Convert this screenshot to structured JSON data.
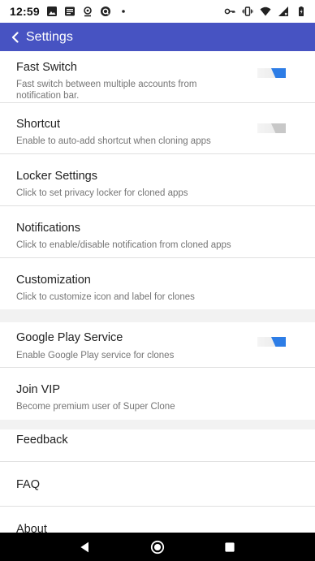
{
  "status_bar": {
    "time": "12:59",
    "left_icons": [
      "image-icon",
      "news-icon",
      "location-icon",
      "q-app-icon",
      "dot-icon"
    ],
    "right_icons": [
      "key-icon",
      "vibrate-icon",
      "wifi-icon",
      "signal-icon",
      "battery-icon"
    ]
  },
  "app_bar": {
    "title": "Settings",
    "color": "#4753c2"
  },
  "settings": [
    {
      "title": "Fast Switch",
      "subtitle": "Fast switch between multiple accounts from notification bar.",
      "toggle": true
    },
    {
      "title": "Shortcut",
      "subtitle": "Enable to auto-add shortcut when cloning apps",
      "toggle": false
    },
    {
      "title": "Locker Settings",
      "subtitle": "Click to set privacy locker for cloned apps"
    },
    {
      "title": "Notifications",
      "subtitle": "Click to enable/disable notification from cloned apps"
    },
    {
      "title": "Customization",
      "subtitle": "Click to customize icon and label for clones"
    },
    {
      "title": "Google Play Service",
      "subtitle": "Enable Google Play service for clones",
      "toggle": true
    },
    {
      "title": "Join VIP",
      "subtitle": "Become premium user of Super Clone"
    },
    {
      "title": "Feedback"
    },
    {
      "title": "FAQ"
    },
    {
      "title": "About"
    }
  ],
  "nav_bar": {
    "buttons": [
      "back-triangle-icon",
      "home-circle-icon",
      "recents-square-icon"
    ]
  },
  "colors": {
    "toggle_on": "#2d7de6",
    "toggle_off": "#c8c8c8"
  }
}
